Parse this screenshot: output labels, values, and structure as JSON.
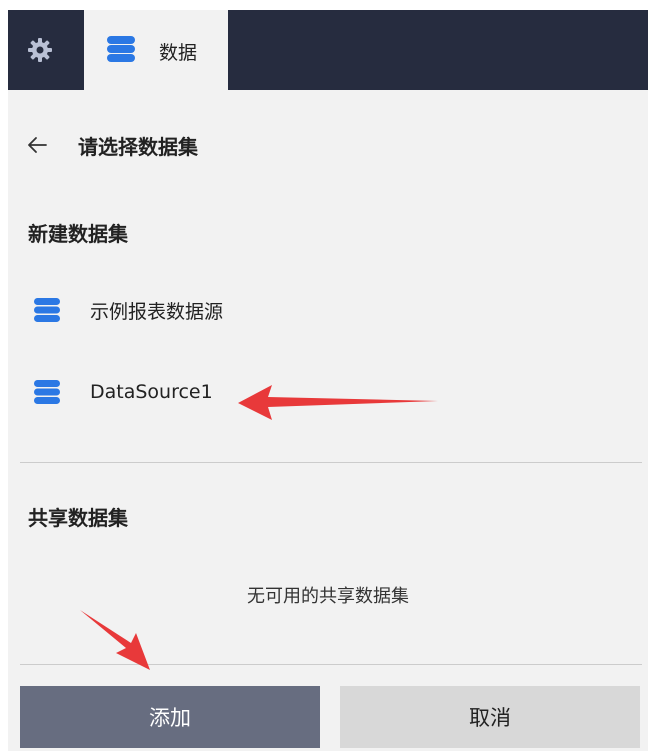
{
  "tabs": {
    "settings_icon": "gear-icon",
    "data_icon": "database-icon",
    "data_label": "数据"
  },
  "header": {
    "back_icon": "back-arrow-icon",
    "title": "请选择数据集"
  },
  "new_dataset": {
    "title": "新建数据集",
    "items": [
      {
        "label": "示例报表数据源",
        "icon": "database-icon"
      },
      {
        "label": "DataSource1",
        "icon": "database-icon"
      }
    ]
  },
  "shared_dataset": {
    "title": "共享数据集",
    "empty_text": "无可用的共享数据集"
  },
  "buttons": {
    "add": "添加",
    "cancel": "取消"
  },
  "colors": {
    "tabbar": "#262c3f",
    "panel": "#f2f2f2",
    "accent": "#2b78e4",
    "add_button": "#676d80",
    "cancel_button": "#d8d8d8",
    "annotation_arrow": "#e8393a"
  }
}
